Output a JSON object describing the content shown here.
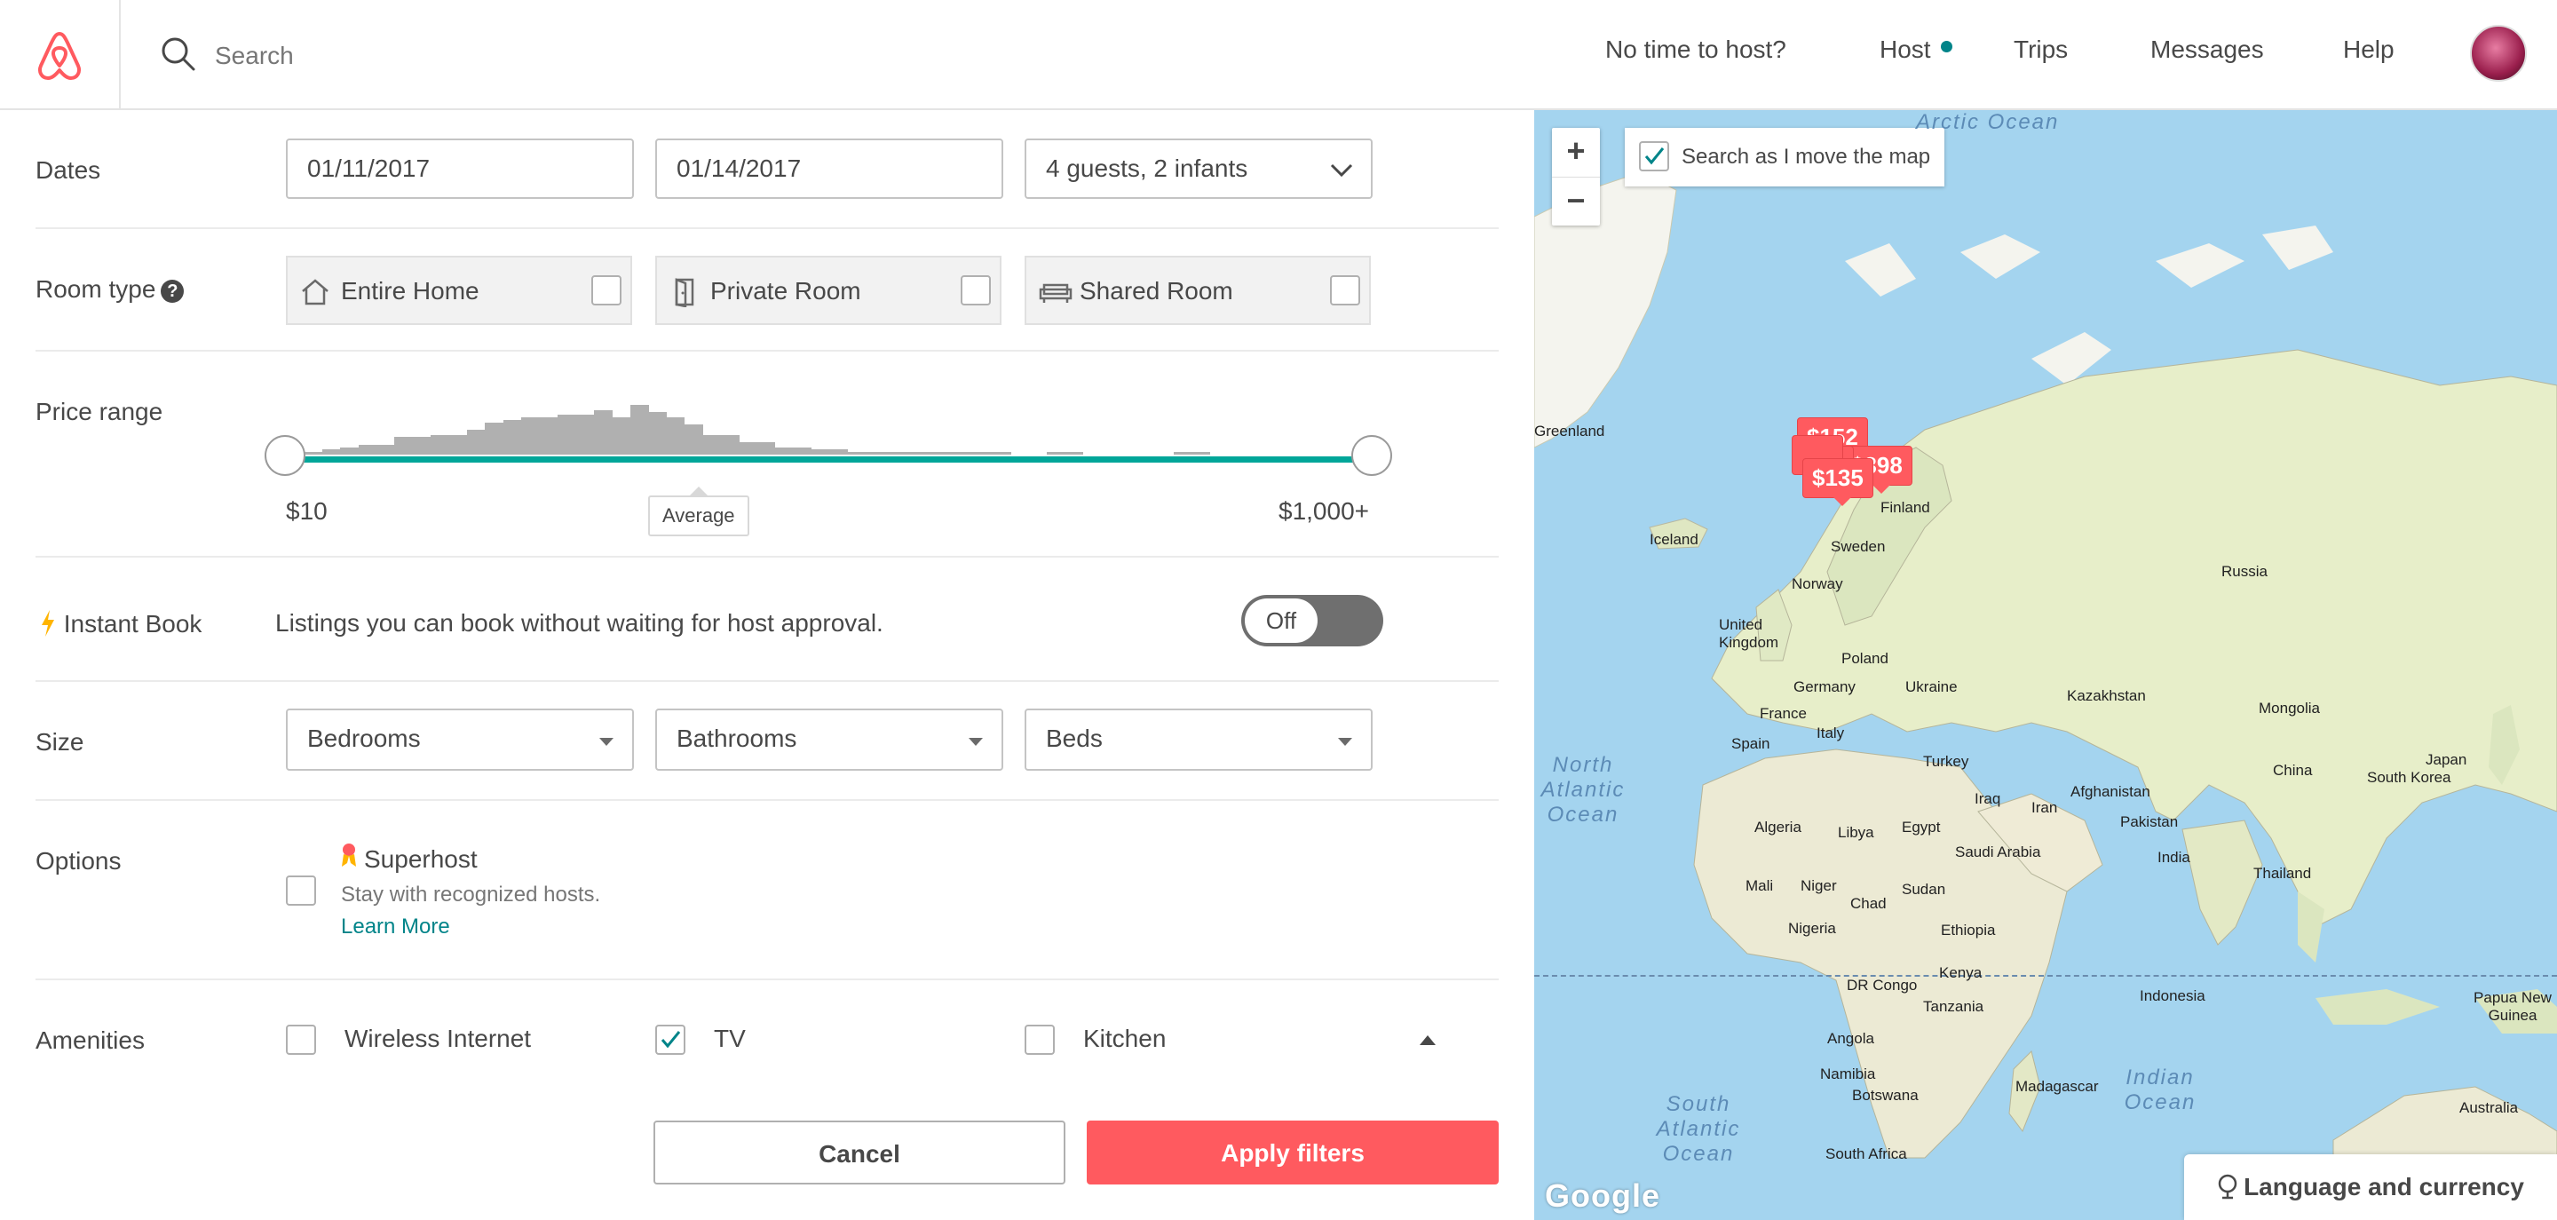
{
  "header": {
    "search_placeholder": "Search",
    "nav": [
      "No time to host?",
      "Host",
      "Trips",
      "Messages",
      "Help"
    ]
  },
  "filters": {
    "dates": {
      "label": "Dates",
      "checkin": "01/11/2017",
      "checkout": "01/14/2017",
      "guests": "4 guests, 2 infants"
    },
    "room_type": {
      "label": "Room type",
      "help_icon": "?",
      "options": [
        {
          "label": "Entire Home",
          "icon": "home-icon",
          "checked": false
        },
        {
          "label": "Private Room",
          "icon": "door-icon",
          "checked": false
        },
        {
          "label": "Shared Room",
          "icon": "couch-icon",
          "checked": false
        }
      ]
    },
    "price_range": {
      "label": "Price range",
      "min_label": "$10",
      "max_label": "$1,000+",
      "average_label": "Average",
      "histogram": [
        1,
        1,
        2,
        3,
        4,
        4,
        7,
        7,
        8,
        8,
        10,
        13,
        14,
        15,
        15,
        16,
        16,
        18,
        15,
        20,
        17,
        15,
        12,
        8,
        8,
        5,
        5,
        3,
        3,
        2,
        2,
        1,
        1,
        1,
        1,
        1,
        1,
        1,
        1,
        1,
        0,
        0,
        1,
        1,
        0,
        0,
        0,
        0,
        0,
        1,
        1,
        0,
        0,
        0,
        0,
        0,
        0,
        0,
        0,
        0
      ]
    },
    "instant_book": {
      "label": "Instant Book",
      "description": "Listings you can book without waiting for host approval.",
      "toggle": "Off"
    },
    "size": {
      "label": "Size",
      "bedrooms": "Bedrooms",
      "bathrooms": "Bathrooms",
      "beds": "Beds"
    },
    "options": {
      "label": "Options",
      "superhost_title": "Superhost",
      "superhost_sub": "Stay with recognized hosts.",
      "learn_more": "Learn More"
    },
    "amenities": {
      "label": "Amenities",
      "items": [
        {
          "label": "Wireless Internet",
          "checked": false
        },
        {
          "label": "TV",
          "checked": true
        },
        {
          "label": "Kitchen",
          "checked": false
        }
      ]
    },
    "cancel": "Cancel",
    "apply": "Apply filters"
  },
  "map": {
    "zoom_in": "+",
    "zoom_out": "−",
    "search_as_move": "Search as I move the map",
    "search_as_move_checked": true,
    "pins": [
      "$135",
      "$152",
      "$398"
    ],
    "countries": [
      "Greenland",
      "Iceland",
      "Finland",
      "Sweden",
      "Norway",
      "Russia",
      "United Kingdom",
      "Poland",
      "Germany",
      "Ukraine",
      "France",
      "Kazakhstan",
      "Mongolia",
      "Spain",
      "Italy",
      "Turkey",
      "China",
      "Japan",
      "South Korea",
      "Afghanistan",
      "Iraq",
      "Iran",
      "Pakistan",
      "Algeria",
      "Libya",
      "Egypt",
      "Saudi Arabia",
      "India",
      "Thailand",
      "Mali",
      "Niger",
      "Chad",
      "Sudan",
      "Nigeria",
      "Ethiopia",
      "Kenya",
      "DR Congo",
      "Tanzania",
      "Indonesia",
      "Papua New Guinea",
      "Angola",
      "Namibia",
      "Botswana",
      "Madagascar",
      "South Africa",
      "Australia"
    ],
    "oceans": [
      "Arctic Ocean",
      "North Atlantic Ocean",
      "South Atlantic Ocean",
      "Indian Ocean"
    ],
    "attribution": "Google",
    "language_button": "Language and currency"
  }
}
